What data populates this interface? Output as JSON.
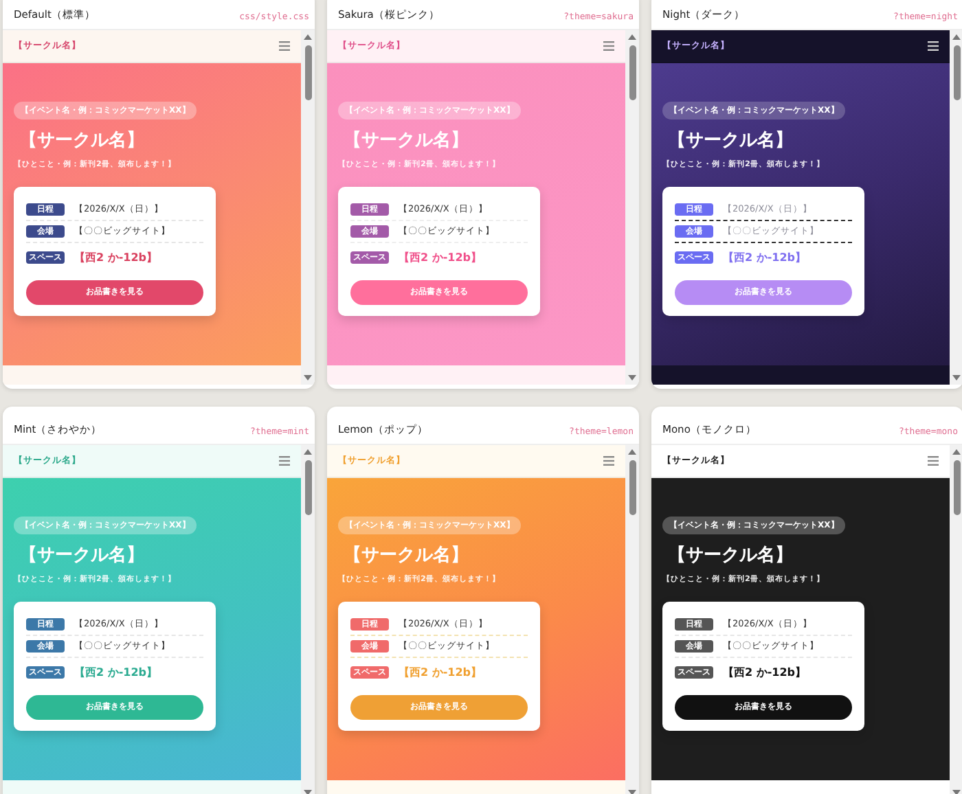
{
  "previews": [
    {
      "name": "Default（標準）",
      "path": "css/style.css",
      "kind": "default",
      "site": {
        "circle_name": "【サークル名】",
        "event_badge": "【イベント名・例：コミックマーケットXX】",
        "title": "【サークル名】",
        "tagline": "【ひとこと・例：新刊2冊、頒布します！】",
        "info": [
          {
            "label": "日程",
            "value": "【2026/X/X（日）】",
            "kind": "plain"
          },
          {
            "label": "会場",
            "value": "【〇〇ビッグサイト】",
            "kind": "plain"
          },
          {
            "label": "スペース",
            "value": "【西2 か-12b】",
            "kind": "space"
          }
        ],
        "button": "お品書きを見る"
      }
    },
    {
      "name": "Sakura（桜ピンク）",
      "path": "?theme=sakura",
      "kind": "sakura",
      "site": {
        "circle_name": "【サークル名】",
        "event_badge": "【イベント名・例：コミックマーケットXX】",
        "title": "【サークル名】",
        "tagline": "【ひとこと・例：新刊2冊、頒布します！】",
        "info": [
          {
            "label": "日程",
            "value": "【2026/X/X（日）】",
            "kind": "plain"
          },
          {
            "label": "会場",
            "value": "【〇〇ビッグサイト】",
            "kind": "plain"
          },
          {
            "label": "スペース",
            "value": "【西2 か-12b】",
            "kind": "space"
          }
        ],
        "button": "お品書きを見る"
      }
    },
    {
      "name": "Night（ダーク）",
      "path": "?theme=night",
      "kind": "night",
      "site": {
        "circle_name": "【サークル名】",
        "event_badge": "【イベント名・例：コミックマーケットXX】",
        "title": "【サークル名】",
        "tagline": "【ひとこと・例：新刊2冊、頒布します！】",
        "info": [
          {
            "label": "日程",
            "value": "【2026/X/X（日）】",
            "kind": "plain"
          },
          {
            "label": "会場",
            "value": "【〇〇ビッグサイト】",
            "kind": "plain"
          },
          {
            "label": "スペース",
            "value": "【西2 か-12b】",
            "kind": "space"
          }
        ],
        "button": "お品書きを見る"
      }
    },
    {
      "name": "Mint（さわやか）",
      "path": "?theme=mint",
      "kind": "mint",
      "site": {
        "circle_name": "【サークル名】",
        "event_badge": "【イベント名・例：コミックマーケットXX】",
        "title": "【サークル名】",
        "tagline": "【ひとこと・例：新刊2冊、頒布します！】",
        "info": [
          {
            "label": "日程",
            "value": "【2026/X/X（日）】",
            "kind": "plain"
          },
          {
            "label": "会場",
            "value": "【〇〇ビッグサイト】",
            "kind": "plain"
          },
          {
            "label": "スペース",
            "value": "【西2 か-12b】",
            "kind": "space"
          }
        ],
        "button": "お品書きを見る"
      }
    },
    {
      "name": "Lemon（ポップ）",
      "path": "?theme=lemon",
      "kind": "lemon",
      "site": {
        "circle_name": "【サークル名】",
        "event_badge": "【イベント名・例：コミックマーケットXX】",
        "title": "【サークル名】",
        "tagline": "【ひとこと・例：新刊2冊、頒布します！】",
        "info": [
          {
            "label": "日程",
            "value": "【2026/X/X（日）】",
            "kind": "plain"
          },
          {
            "label": "会場",
            "value": "【〇〇ビッグサイト】",
            "kind": "plain"
          },
          {
            "label": "スペース",
            "value": "【西2 か-12b】",
            "kind": "space"
          }
        ],
        "button": "お品書きを見る"
      }
    },
    {
      "name": "Mono（モノクロ）",
      "path": "?theme=mono",
      "kind": "mono",
      "site": {
        "circle_name": "【サークル名】",
        "event_badge": "【イベント名・例：コミックマーケットXX】",
        "title": "【サークル名】",
        "tagline": "【ひとこと・例：新刊2冊、頒布します！】",
        "info": [
          {
            "label": "日程",
            "value": "【2026/X/X（日）】",
            "kind": "plain"
          },
          {
            "label": "会場",
            "value": "【〇〇ビッグサイト】",
            "kind": "plain"
          },
          {
            "label": "スペース",
            "value": "【西2 か-12b】",
            "kind": "space"
          }
        ],
        "button": "お品書きを見る"
      }
    }
  ]
}
